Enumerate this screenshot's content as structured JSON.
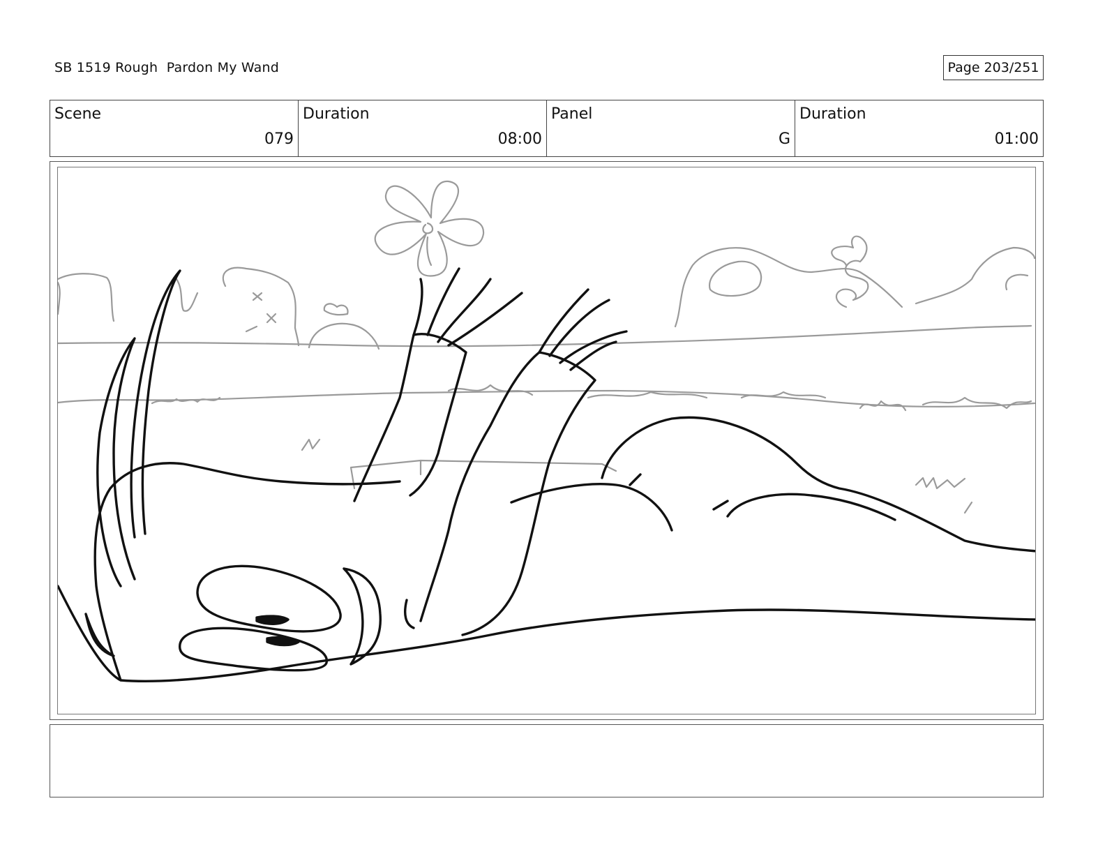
{
  "header": {
    "title": "SB 1519 Rough  Pardon My Wand",
    "page": "Page 203/251"
  },
  "info": [
    {
      "label": "Scene",
      "value": "079"
    },
    {
      "label": "Duration",
      "value": "08:00"
    },
    {
      "label": "Panel",
      "value": "G"
    },
    {
      "label": "Duration",
      "value": "01:00"
    }
  ],
  "panel": {
    "image": "storyboard-sketch",
    "line_color": "#111111",
    "background_color": "#9a9a9a"
  },
  "notes": {
    "text": ""
  }
}
